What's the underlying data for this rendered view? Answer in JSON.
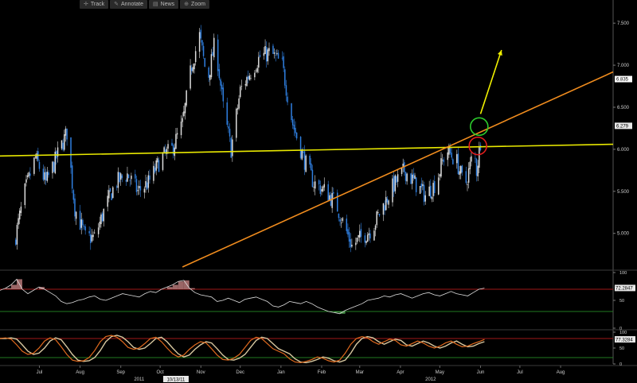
{
  "toolbar": {
    "track_label": "Track",
    "annotate_label": "Annotate",
    "news_label": "News",
    "zoom_label": "Zoom",
    "icons": {
      "track": "crosshair-icon",
      "annotate": "pencil-icon",
      "news": "news-icon",
      "zoom": "magnifier-icon"
    }
  },
  "chart_data": [
    {
      "type": "candlestick",
      "title": "",
      "ylim": [
        4.6,
        7.7
      ],
      "yticks": [
        "7.500",
        "7.000",
        "6.500",
        "6.000",
        "5.500",
        "5.000"
      ],
      "ytick_values": [
        7.5,
        7.0,
        6.5,
        6.0,
        5.5,
        5.0
      ],
      "last_price_labels": [
        {
          "text": "6.835",
          "value": 6.835
        },
        {
          "text": "6.279",
          "value": 6.279
        }
      ],
      "price_path": [
        [
          "2011-06-12",
          4.9
        ],
        [
          "2011-06-20",
          5.5
        ],
        [
          "2011-06-28",
          5.9
        ],
        [
          "2011-07-06",
          5.6
        ],
        [
          "2011-07-14",
          5.9
        ],
        [
          "2011-07-22",
          6.2
        ],
        [
          "2011-07-28",
          5.3
        ],
        [
          "2011-08-05",
          4.95
        ],
        [
          "2011-08-12",
          4.95
        ],
        [
          "2011-08-20",
          5.3
        ],
        [
          "2011-08-28",
          5.6
        ],
        [
          "2011-09-06",
          5.7
        ],
        [
          "2011-09-14",
          5.5
        ],
        [
          "2011-09-22",
          5.6
        ],
        [
          "2011-10-02",
          5.9
        ],
        [
          "2011-10-10",
          6.0
        ],
        [
          "2011-10-18",
          6.3
        ],
        [
          "2011-10-25",
          7.0
        ],
        [
          "2011-10-31",
          7.35
        ],
        [
          "2011-11-06",
          6.8
        ],
        [
          "2011-11-12",
          7.3
        ],
        [
          "2011-11-18",
          6.5
        ],
        [
          "2011-11-24",
          6.0
        ],
        [
          "2011-12-01",
          6.7
        ],
        [
          "2011-12-08",
          6.9
        ],
        [
          "2011-12-16",
          7.1
        ],
        [
          "2011-12-24",
          7.15
        ],
        [
          "2012-01-02",
          7.0
        ],
        [
          "2012-01-10",
          6.3
        ],
        [
          "2012-01-18",
          5.9
        ],
        [
          "2012-01-26",
          5.6
        ],
        [
          "2012-02-04",
          5.5
        ],
        [
          "2012-02-12",
          5.35
        ],
        [
          "2012-02-18",
          5.1
        ],
        [
          "2012-02-24",
          4.85
        ],
        [
          "2012-03-02",
          4.95
        ],
        [
          "2012-03-10",
          5.05
        ],
        [
          "2012-03-18",
          5.3
        ],
        [
          "2012-03-26",
          5.55
        ],
        [
          "2012-04-04",
          5.75
        ],
        [
          "2012-04-12",
          5.6
        ],
        [
          "2012-04-20",
          5.45
        ],
        [
          "2012-04-28",
          5.6
        ],
        [
          "2012-05-06",
          6.0
        ],
        [
          "2012-05-14",
          5.85
        ],
        [
          "2012-05-20",
          5.55
        ],
        [
          "2012-05-24",
          5.8
        ],
        [
          "2012-05-27",
          6.0
        ],
        [
          "2012-05-29",
          5.75
        ],
        [
          "2012-06-01",
          6.1
        ],
        [
          "2012-06-03",
          6.25
        ]
      ],
      "trendlines": [
        {
          "color": "#e8e800",
          "from": [
            "2011-06-01",
            5.92
          ],
          "to": [
            "2012-09-10",
            6.06
          ]
        },
        {
          "color": "#f08c1e",
          "from": [
            "2011-10-18",
            4.6
          ],
          "to": [
            "2012-09-10",
            6.92
          ]
        }
      ],
      "arrow": {
        "color": "#f0f000",
        "from": [
          "2012-06-01",
          6.42
        ],
        "to": [
          "2012-06-17",
          7.18
        ]
      },
      "circles": [
        {
          "color": "#e01e1e",
          "center": [
            "2012-05-30",
            6.04
          ]
        },
        {
          "color": "#2ccc2c",
          "center": [
            "2012-05-31",
            6.27
          ]
        }
      ]
    },
    {
      "type": "line",
      "name": "indicator-1",
      "ylim": [
        0,
        100
      ],
      "yticks": [
        "100",
        "50",
        "0"
      ],
      "ytick_values": [
        100,
        50,
        0
      ],
      "levels": [
        {
          "value": 70,
          "color": "#a01818"
        },
        {
          "value": 30,
          "color": "#1f7a1f"
        }
      ],
      "last_label": {
        "text": "72.2847",
        "value": 72.28
      },
      "values": [
        68,
        72,
        78,
        88,
        70,
        62,
        68,
        74,
        70,
        64,
        58,
        48,
        44,
        46,
        50,
        52,
        56,
        58,
        52,
        50,
        54,
        58,
        62,
        60,
        58,
        56,
        62,
        66,
        64,
        70,
        74,
        78,
        84,
        86,
        72,
        64,
        60,
        58,
        56,
        48,
        50,
        54,
        50,
        46,
        52,
        54,
        56,
        52,
        48,
        40,
        38,
        42,
        48,
        46,
        44,
        48,
        44,
        38,
        34,
        30,
        28,
        26,
        32,
        36,
        40,
        44,
        50,
        52,
        54,
        58,
        56,
        60,
        62,
        58,
        54,
        58,
        62,
        64,
        60,
        58,
        62,
        66,
        62,
        60,
        58,
        64,
        70,
        72
      ]
    },
    {
      "type": "line",
      "name": "indicator-2",
      "ylim": [
        0,
        100
      ],
      "yticks": [
        "100",
        "50",
        "0"
      ],
      "ytick_values": [
        100,
        50,
        0
      ],
      "levels": [
        {
          "value": 80,
          "color": "#a01818"
        },
        {
          "value": 20,
          "color": "#1f7a1f"
        }
      ],
      "last_label": {
        "text": "77.3284",
        "value": 77.33
      },
      "values": [
        80,
        82,
        78,
        60,
        40,
        30,
        34,
        50,
        72,
        82,
        76,
        54,
        30,
        12,
        8,
        10,
        20,
        42,
        70,
        86,
        90,
        84,
        70,
        52,
        46,
        50,
        64,
        80,
        84,
        70,
        50,
        32,
        22,
        28,
        46,
        60,
        70,
        66,
        48,
        28,
        14,
        12,
        18,
        30,
        52,
        74,
        84,
        80,
        64,
        48,
        40,
        32,
        16,
        6,
        4,
        8,
        14,
        22,
        18,
        10,
        6,
        12,
        34,
        62,
        80,
        86,
        82,
        70,
        62,
        70,
        78,
        74,
        60,
        56,
        64,
        72,
        66,
        56,
        50,
        56,
        66,
        72,
        62,
        54,
        56,
        64,
        70,
        77
      ]
    }
  ],
  "x_axis": {
    "labels": [
      {
        "text": "Jul",
        "date": "2011-07-01"
      },
      {
        "text": "Aug",
        "date": "2011-08-01"
      },
      {
        "text": "Sep",
        "date": "2011-09-01"
      },
      {
        "text": "Oct",
        "date": "2011-10-01"
      },
      {
        "text": "Nov",
        "date": "2011-11-01"
      },
      {
        "text": "Dec",
        "date": "2011-12-01"
      },
      {
        "text": "Jan",
        "date": "2012-01-01"
      },
      {
        "text": "Feb",
        "date": "2012-02-01"
      },
      {
        "text": "Mar",
        "date": "2012-03-01"
      },
      {
        "text": "Apr",
        "date": "2012-04-01"
      },
      {
        "text": "May",
        "date": "2012-05-01"
      },
      {
        "text": "Jun",
        "date": "2012-06-01"
      },
      {
        "text": "Jul",
        "date": "2012-07-01"
      },
      {
        "text": "Aug",
        "date": "2012-08-01"
      }
    ],
    "years": [
      {
        "text": "2011",
        "date": "2011-09-15"
      },
      {
        "text": "2012",
        "date": "2012-04-24"
      }
    ],
    "cursor_label": {
      "text": "10/13/11",
      "date": "2011-10-13"
    }
  },
  "colors": {
    "up_candle": "#dddddd",
    "down_candle": "#2f7fe0",
    "axis": "#cccccc",
    "indicator_line": "#dddddd",
    "indicator_fill_high": "#c08080",
    "indicator_fill_low": "#58b058",
    "stoch_fast": "#e06a1e",
    "stoch_slow": "#d8c8a0"
  }
}
